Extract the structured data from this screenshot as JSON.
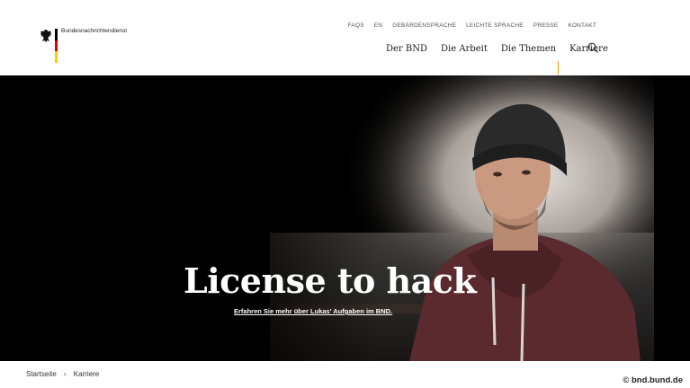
{
  "header": {
    "logo_text": "Bundesnachrichtendienst",
    "meta_nav": [
      "FAQS",
      "EN",
      "GEBÄRDENSPRACHE",
      "LEICHTE SPRACHE",
      "PRESSE",
      "KONTAKT"
    ],
    "main_nav": [
      "Der BND",
      "Die Arbeit",
      "Die Themen",
      "Karriere"
    ],
    "active_nav": "Karriere",
    "accent_color": "#e0a000"
  },
  "hero": {
    "title": "License to hack",
    "link_text": "Erfahren Sie mehr über Lukas' Aufgaben im BND."
  },
  "breadcrumb": {
    "items": [
      "Startseite",
      "Karriere"
    ],
    "separator": "›"
  },
  "credit": "© bnd.bund.de",
  "flag_colors": [
    "#000000",
    "#dd0000",
    "#ffce00"
  ]
}
